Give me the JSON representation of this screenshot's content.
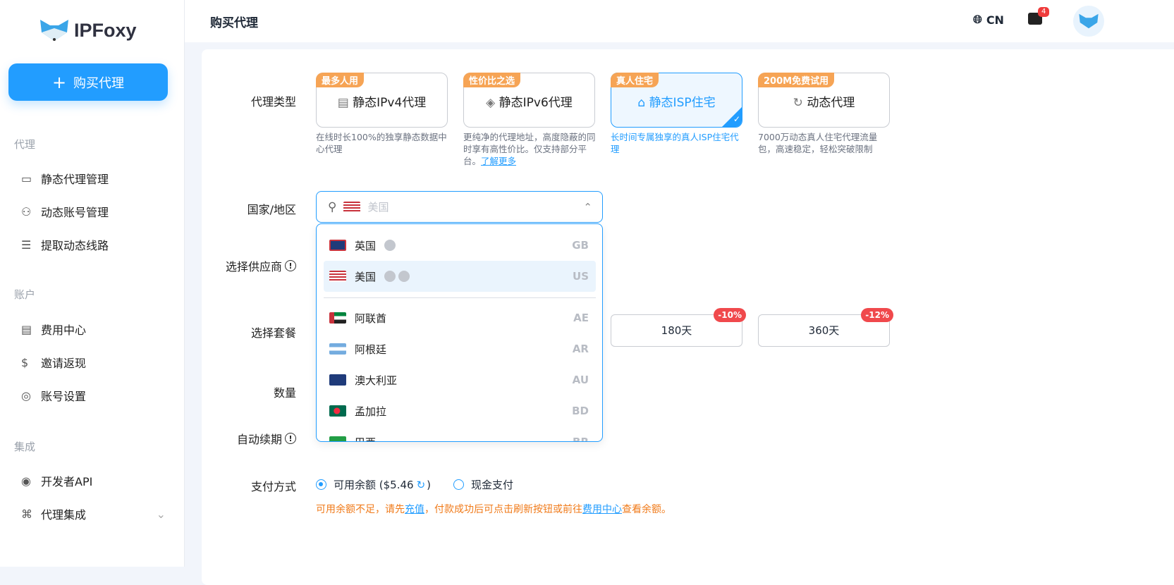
{
  "brand": {
    "name": "IPFoxy"
  },
  "sidebar": {
    "buy_label": "购买代理",
    "sections": [
      {
        "title": "代理"
      },
      {
        "title": "账户"
      },
      {
        "title": "集成"
      }
    ],
    "items": [
      {
        "label": "静态代理管理"
      },
      {
        "label": "动态账号管理"
      },
      {
        "label": "提取动态线路"
      },
      {
        "label": "费用中心"
      },
      {
        "label": "邀请返现"
      },
      {
        "label": "账号设置"
      },
      {
        "label": "开发者API"
      },
      {
        "label": "代理集成"
      }
    ]
  },
  "header": {
    "title": "购买代理",
    "lang": "CN",
    "message_count": "4"
  },
  "form": {
    "labels": {
      "type": "代理类型",
      "country": "国家/地区",
      "provider": "选择供应商",
      "plan": "选择套餐",
      "qty": "数量",
      "renew": "自动续期",
      "pay": "支付方式"
    },
    "types": [
      {
        "tag": "最多人用",
        "name": "静态IPv4代理",
        "desc": "在线时长100%的独享静态数据中心代理"
      },
      {
        "tag": "性价比之选",
        "name": "静态IPv6代理",
        "desc": "更纯净的代理地址，高度隐蔽的同时享有高性价比。仅支持部分平台。",
        "link": "了解更多"
      },
      {
        "tag": "真人住宅",
        "name": "静态ISP住宅",
        "desc": "长时间专属独享的真人ISP住宅代理",
        "selected": true
      },
      {
        "tag": "200M免费试用",
        "name": "动态代理",
        "desc": "7000万动态真人住宅代理流量包，高速稳定，轻松突破限制"
      }
    ],
    "country_placeholder": "美国",
    "countries": [
      {
        "name": "英国",
        "code": "GB"
      },
      {
        "name": "美国",
        "code": "US"
      },
      {
        "name": "阿联酋",
        "code": "AE"
      },
      {
        "name": "阿根廷",
        "code": "AR"
      },
      {
        "name": "澳大利亚",
        "code": "AU"
      },
      {
        "name": "孟加拉",
        "code": "BD"
      },
      {
        "name": "巴西",
        "code": "BR"
      }
    ],
    "plans": [
      {
        "label": "180天",
        "discount": "-10%"
      },
      {
        "label": "360天",
        "discount": "-12%"
      }
    ],
    "pay": {
      "balance": "可用余额 ($5.46",
      "close": ")",
      "cash": "现金支付"
    },
    "warning": {
      "a": "可用余额不足，请先",
      "link1": "充值",
      "b": "，付款成功后可点击刷新按钮或前往",
      "link2": "费用中心",
      "c": "查看余额。"
    }
  },
  "colors": {
    "accent": "#229dff",
    "tag": "#f6a455",
    "discount": "#f0494c",
    "warning": "#f07a19"
  }
}
